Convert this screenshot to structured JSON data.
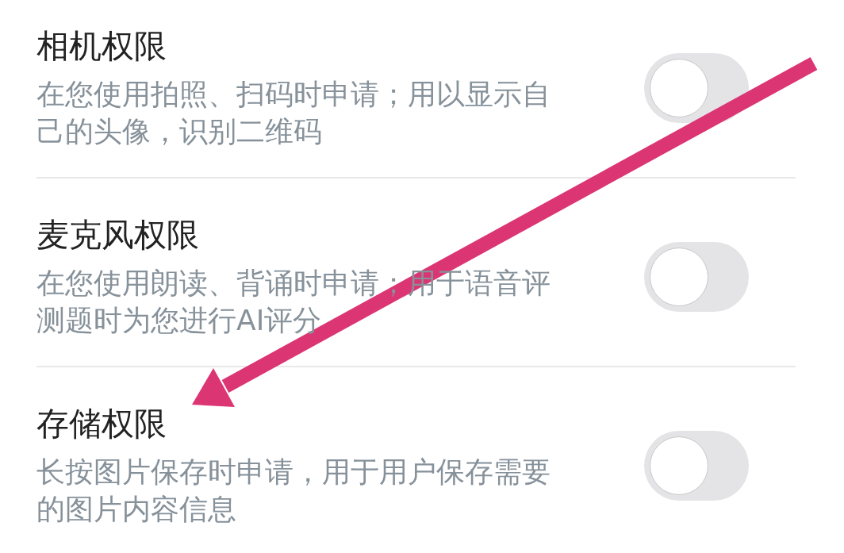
{
  "permissions": [
    {
      "title": "相机权限",
      "description": "在您使用拍照、扫码时申请；用以显示自己的头像，识别二维码",
      "on": false
    },
    {
      "title": "麦克风权限",
      "description": "在您使用朗读、背诵时申请；用于语音评测题时为您进行AI评分",
      "on": false
    },
    {
      "title": "存储权限",
      "description": "长按图片保存时申请，用于用户保存需要的图片内容信息",
      "on": false
    }
  ]
}
